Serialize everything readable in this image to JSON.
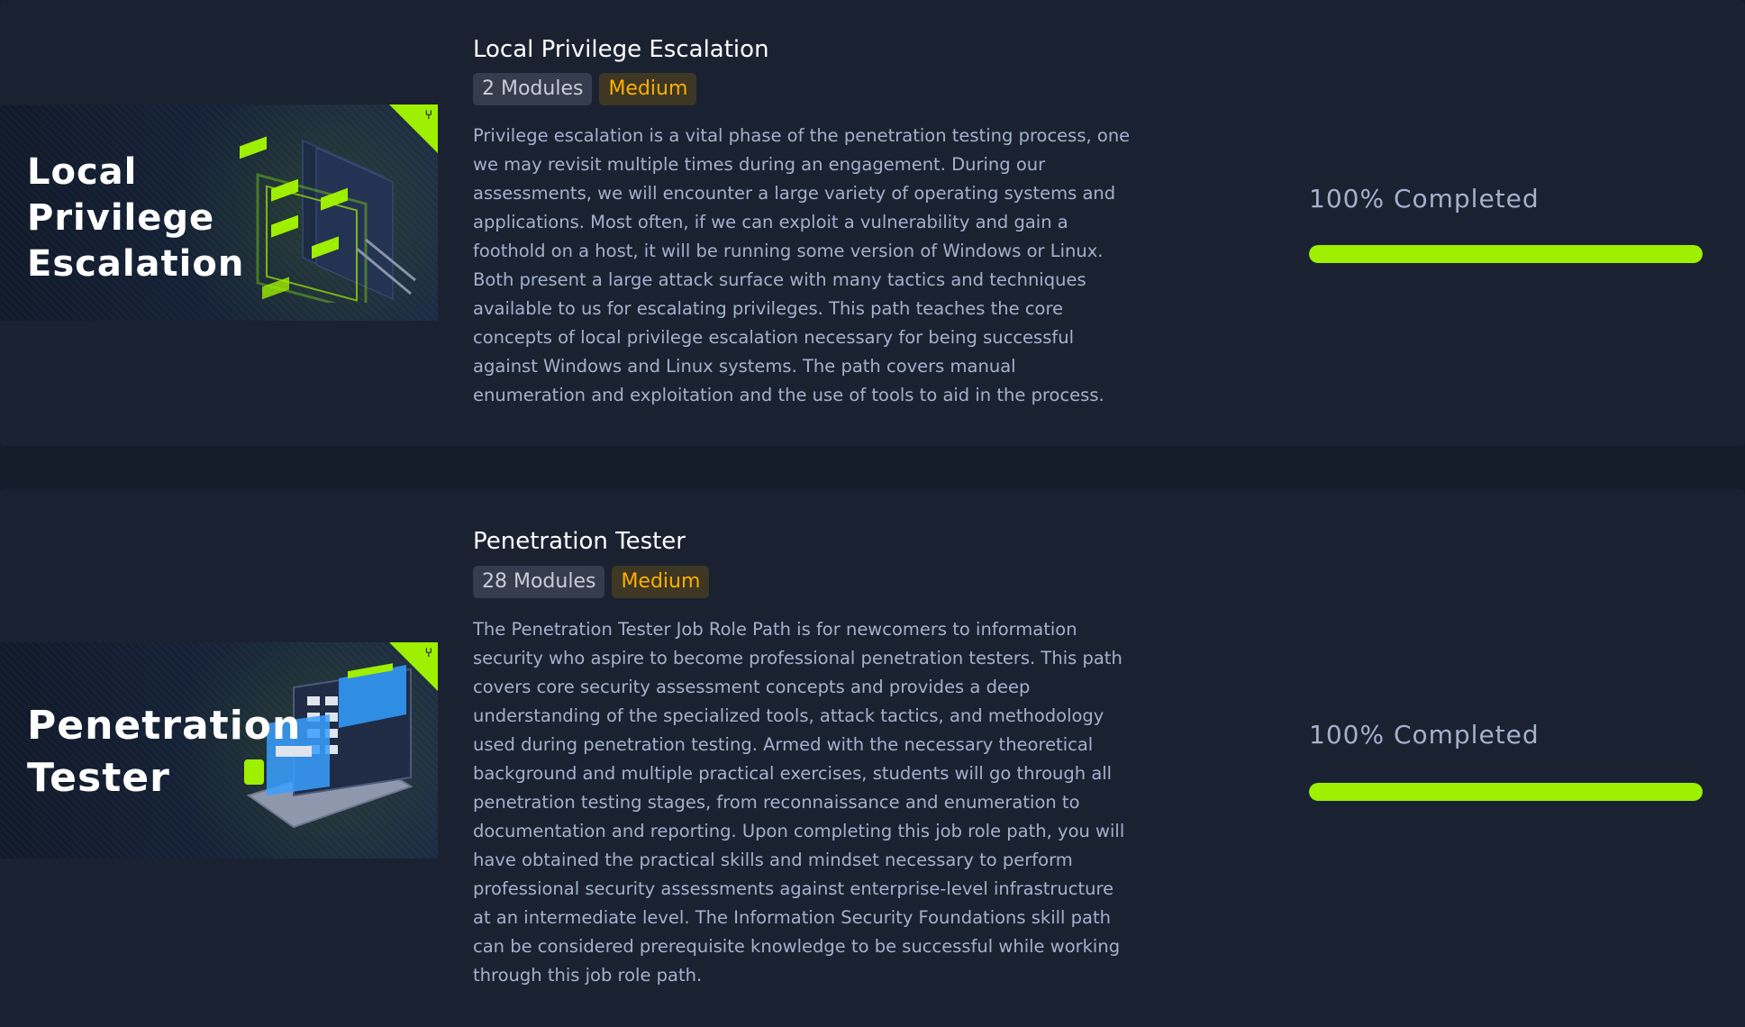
{
  "colors": {
    "accent": "#9fef00",
    "medium": "#ffaf00",
    "text_secondary": "#a4b1cd",
    "card_bg": "#1a2232",
    "page_bg": "#151d2a"
  },
  "paths": [
    {
      "thumbnail_title": "Local\nPrivilege\nEscalation",
      "corner_icon": "path-icon",
      "title": "Local Privilege Escalation",
      "modules": "2 Modules",
      "difficulty": "Medium",
      "description": "Privilege escalation is a vital phase of the penetration testing process, one we may revisit multiple times during an engagement. During our assessments, we will encounter a large variety of operating systems and applications. Most often, if we can exploit a vulnerability and gain a foothold on a host, it will be running some version of Windows or Linux. Both present a large attack surface with many tactics and techniques available to us for escalating privileges. This path teaches the core concepts of local privilege escalation necessary for being successful against Windows and Linux systems. The path covers manual enumeration and exploitation and the use of tools to aid in the process.",
      "progress_label": "100% Completed",
      "progress_percent": 100
    },
    {
      "thumbnail_title": "Penetration\nTester",
      "corner_icon": "path-icon",
      "title": "Penetration Tester",
      "modules": "28 Modules",
      "difficulty": "Medium",
      "description": "The Penetration Tester Job Role Path is for newcomers to information security who aspire to become professional penetration testers. This path covers core security assessment concepts and provides a deep understanding of the specialized tools, attack tactics, and methodology used during penetration testing. Armed with the necessary theoretical background and multiple practical exercises, students will go through all penetration testing stages, from reconnaissance and enumeration to documentation and reporting. Upon completing this job role path, you will have obtained the practical skills and mindset necessary to perform professional security assessments against enterprise-level infrastructure at an intermediate level. The Information Security Foundations skill path can be considered prerequisite knowledge to be successful while working through this job role path.",
      "progress_label": "100% Completed",
      "progress_percent": 100
    }
  ]
}
